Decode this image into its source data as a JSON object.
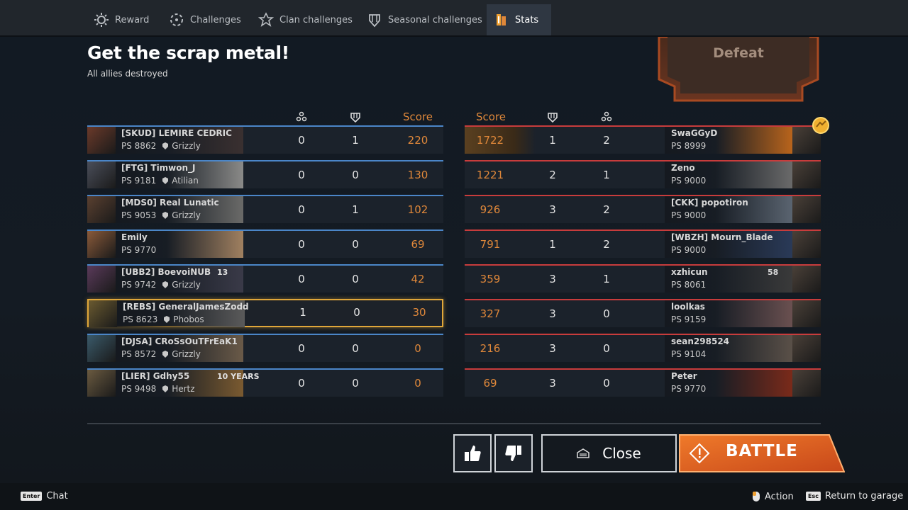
{
  "tabs": [
    {
      "label": "Reward",
      "icon": "reward-icon"
    },
    {
      "label": "Challenges",
      "icon": "challenges-icon"
    },
    {
      "label": "Clan challenges",
      "icon": "clan-challenges-icon"
    },
    {
      "label": "Seasonal challenges",
      "icon": "seasonal-challenges-icon"
    },
    {
      "label": "Stats",
      "icon": "stats-icon",
      "active": true
    }
  ],
  "header": {
    "title": "Get the scrap metal!",
    "subtitle": "All allies destroyed",
    "result": "Defeat"
  },
  "columns": {
    "score": "Score"
  },
  "left_team": [
    {
      "name": "[SKUD] LEMIRE CEDRIC",
      "ps": "PS 8862",
      "clan": "Grizzly",
      "kills": "0",
      "assists": "1",
      "score": "220"
    },
    {
      "name": "[FTG] Timwon_J",
      "ps": "PS 9181",
      "clan": "Atilian",
      "kills": "0",
      "assists": "0",
      "score": "130"
    },
    {
      "name": "[MDS0] Real Lunatic",
      "ps": "PS 9053",
      "clan": "Grizzly",
      "kills": "0",
      "assists": "1",
      "score": "102"
    },
    {
      "name": "Emily",
      "ps": "PS 9770",
      "clan": "",
      "kills": "0",
      "assists": "0",
      "score": "69"
    },
    {
      "name": "[UBB2] BoevoiNUB",
      "ps": "PS 9742",
      "clan": "Grizzly",
      "kills": "0",
      "assists": "0",
      "score": "42",
      "badge": "13"
    },
    {
      "name": "[REBS] GeneralJamesZodd",
      "ps": "PS 8623",
      "clan": "Phobos",
      "kills": "1",
      "assists": "0",
      "score": "30",
      "me": true
    },
    {
      "name": "[DJSA] CRoSsOuTFrEaK1",
      "ps": "PS 8572",
      "clan": "Grizzly",
      "kills": "0",
      "assists": "0",
      "score": "0"
    },
    {
      "name": "[LIER] Gdhy55",
      "ps": "PS 9498",
      "clan": "Hertz",
      "kills": "0",
      "assists": "0",
      "score": "0",
      "badge": "10 YEARS"
    }
  ],
  "right_team": [
    {
      "name": "SwaGGyD",
      "ps": "PS 8999",
      "kills": "2",
      "assists": "1",
      "score": "1722"
    },
    {
      "name": "Zeno",
      "ps": "PS 9000",
      "kills": "1",
      "assists": "2",
      "score": "1221"
    },
    {
      "name": "[CKK] popotiron",
      "ps": "PS 9000",
      "kills": "2",
      "assists": "3",
      "score": "926"
    },
    {
      "name": "[WBZH] Mourn_Blade",
      "ps": "PS 9000",
      "kills": "2",
      "assists": "1",
      "score": "791"
    },
    {
      "name": "xzhicun",
      "ps": "PS 8061",
      "kills": "1",
      "assists": "3",
      "score": "359",
      "badge": "58"
    },
    {
      "name": "loolkas",
      "ps": "PS 9159",
      "kills": "0",
      "assists": "3",
      "score": "327"
    },
    {
      "name": "sean298524",
      "ps": "PS 9104",
      "kills": "0",
      "assists": "3",
      "score": "216"
    },
    {
      "name": "Peter",
      "ps": "PS 9770",
      "kills": "0",
      "assists": "3",
      "score": "69"
    }
  ],
  "actions": {
    "close": "Close",
    "battle": "BATTLE"
  },
  "hints": {
    "chat_key": "Enter",
    "chat": "Chat",
    "action": "Action",
    "garage_key": "Esc",
    "garage": "Return to garage"
  },
  "colors": {
    "accent_orange": "#e0883a",
    "ally_blue": "#4b86c8",
    "enemy_red": "#c83c3c",
    "highlight_gold": "#e0a73a",
    "battle_orange": "#e4611d"
  }
}
